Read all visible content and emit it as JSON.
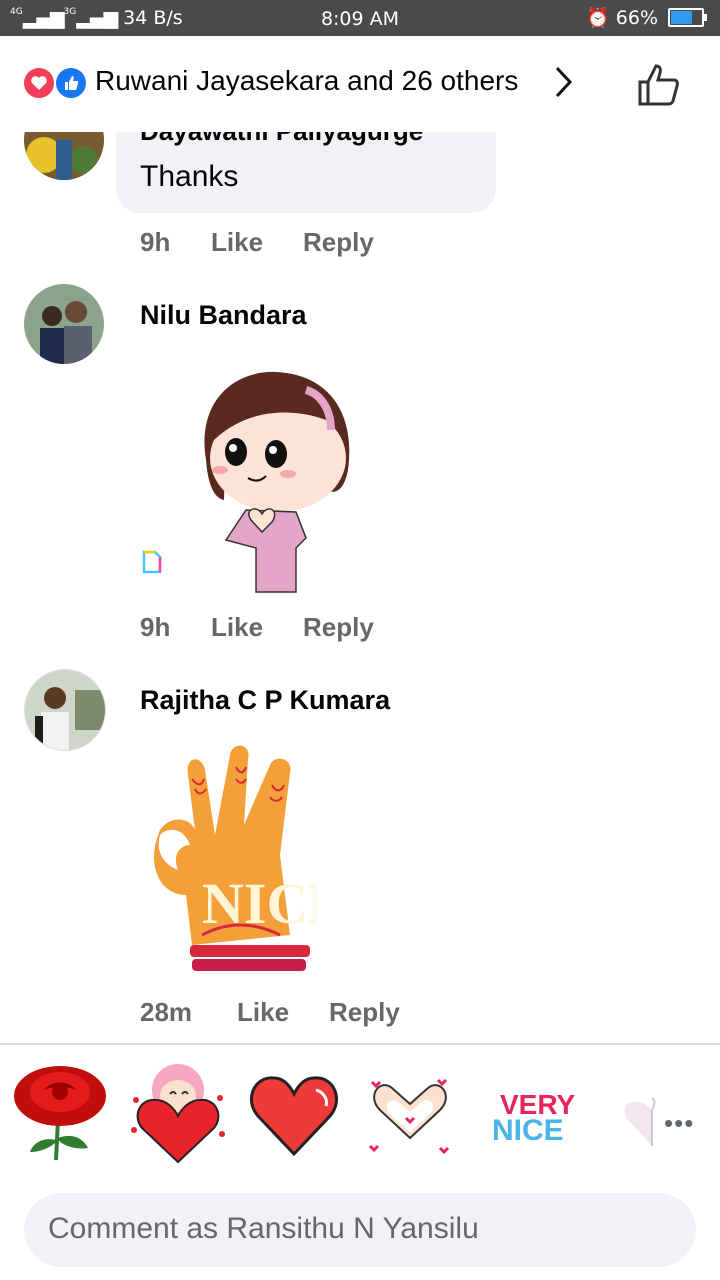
{
  "status_bar": {
    "network": "4G 3G",
    "speed": "34 B/s",
    "time": "8:09 AM",
    "battery": "66%",
    "battery_level": 0.66
  },
  "header": {
    "reactors": "Ruwani Jayasekara and 26 others",
    "reactions": [
      "love-reaction",
      "like-reaction"
    ]
  },
  "comments": [
    {
      "author": "Dayawathi Paliyagurge",
      "text": "Thanks",
      "time": "9h",
      "like": "Like",
      "reply": "Reply"
    },
    {
      "author": "Nilu Bandara",
      "sticker": "girl-heart-hands-sticker",
      "time": "9h",
      "like": "Like",
      "reply": "Reply"
    },
    {
      "author": "Rajitha C P Kumara",
      "sticker": "nice-hand-sticker",
      "sticker_text": "NICE",
      "time": "28m",
      "like": "Like",
      "reply": "Reply"
    }
  ],
  "sticker_tray": {
    "items": [
      "rose-sticker",
      "girl-heart-sticker",
      "red-heart-sticker",
      "heart-hands-sticker",
      "very-nice-sticker",
      "heart-sticker"
    ],
    "very_nice_text_1": "VERY",
    "very_nice_text_2": "NICE",
    "more": "•••"
  },
  "composer": {
    "placeholder": "Comment as Ransithu N Yansilu"
  },
  "colors": {
    "love": "#f33e58",
    "like": "#1877f2",
    "bubble": "#f0f2f5",
    "meta_text": "#65676b"
  }
}
